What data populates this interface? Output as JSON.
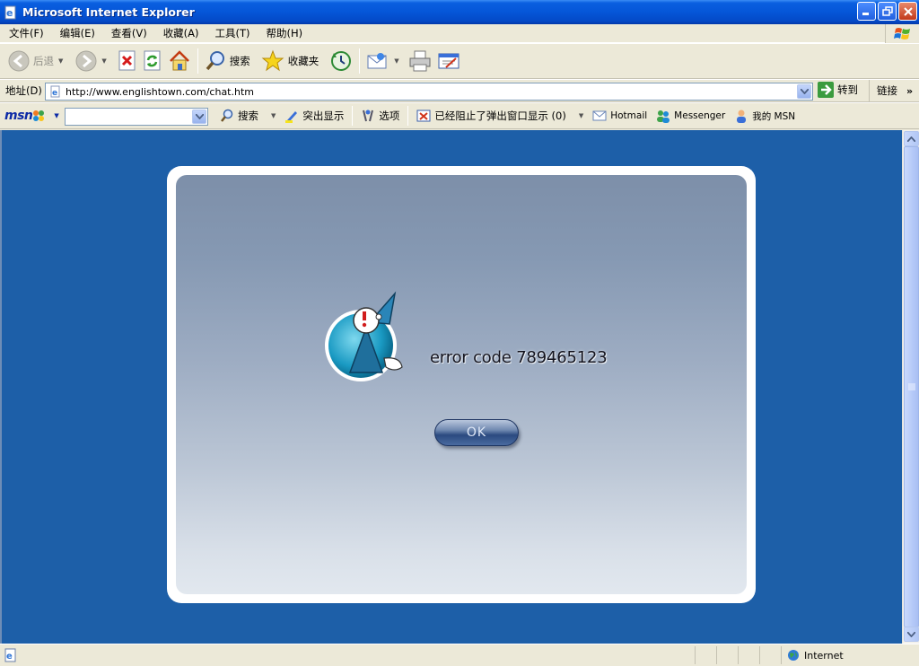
{
  "window": {
    "title": "Microsoft Internet Explorer"
  },
  "menu": [
    "文件(F)",
    "编辑(E)",
    "查看(V)",
    "收藏(A)",
    "工具(T)",
    "帮助(H)"
  ],
  "toolbar": {
    "back_label": "后退",
    "search_label": "搜索",
    "favorites_label": "收藏夹"
  },
  "address": {
    "label": "地址(D)",
    "url": "http://www.englishtown.com/chat.htm",
    "go_label": "转到",
    "links_label": "链接",
    "links_chevron": "»"
  },
  "msn": {
    "logo": "msn",
    "search_label": "搜索",
    "highlight_label": "突出显示",
    "options_label": "选项",
    "popup_blocked_label": "已经阻止了弹出窗口显示 (0)",
    "hotmail_label": "Hotmail",
    "messenger_label": "Messenger",
    "mymsn_label": "我的 MSN"
  },
  "dialog": {
    "error_text": "error code 789465123",
    "ok_label": "OK"
  },
  "status": {
    "zone_label": "Internet"
  },
  "colors": {
    "titlebar": "#0556d8",
    "content_bg": "#1d5fa8",
    "panel": "#8699b3"
  }
}
